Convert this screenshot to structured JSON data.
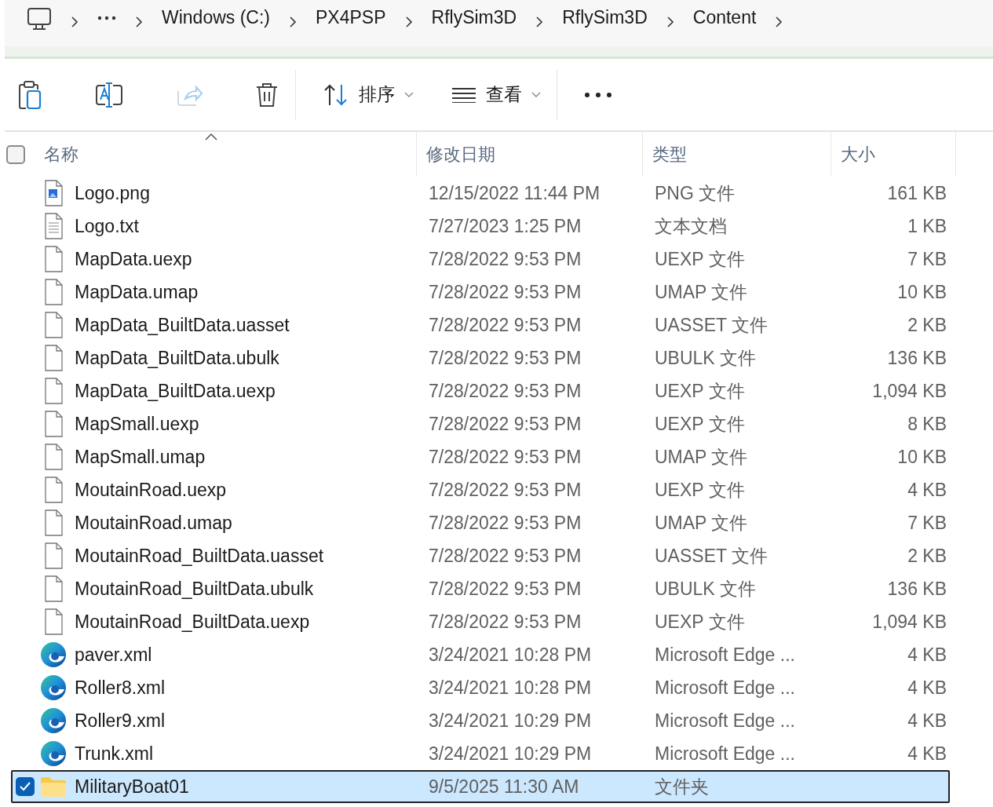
{
  "breadcrumb": [
    {
      "kind": "computer"
    },
    {
      "kind": "overflow"
    },
    {
      "kind": "text",
      "label": "Windows (C:)"
    },
    {
      "kind": "text",
      "label": "PX4PSP"
    },
    {
      "kind": "text",
      "label": "RflySim3D"
    },
    {
      "kind": "text",
      "label": "RflySim3D"
    },
    {
      "kind": "text",
      "label": "Content"
    }
  ],
  "toolbar": [
    {
      "kind": "paste",
      "disabled": false
    },
    {
      "kind": "rename",
      "disabled": false
    },
    {
      "kind": "share",
      "disabled": true
    },
    {
      "kind": "delete",
      "disabled": false
    },
    {
      "kind": "divider"
    },
    {
      "kind": "sort",
      "label": "排序",
      "disabled": false
    },
    {
      "kind": "view",
      "label": "查看",
      "disabled": false
    },
    {
      "kind": "divider"
    },
    {
      "kind": "more",
      "disabled": false
    }
  ],
  "header": {
    "checked": false,
    "columns": [
      "名称",
      "修改日期",
      "类型",
      "大小"
    ]
  },
  "rows": [
    {
      "name": "Logo.png",
      "date": "12/15/2022 11:44 PM",
      "type": "PNG 文件",
      "size": "161 KB",
      "kind": "image",
      "selected": false
    },
    {
      "name": "Logo.txt",
      "date": "7/27/2023 1:25 PM",
      "type": "文本文档",
      "size": "1 KB",
      "kind": "text",
      "selected": false
    },
    {
      "name": "MapData.uexp",
      "date": "7/28/2022 9:53 PM",
      "type": "UEXP 文件",
      "size": "7 KB",
      "kind": "file",
      "selected": false
    },
    {
      "name": "MapData.umap",
      "date": "7/28/2022 9:53 PM",
      "type": "UMAP 文件",
      "size": "10 KB",
      "kind": "file",
      "selected": false
    },
    {
      "name": "MapData_BuiltData.uasset",
      "date": "7/28/2022 9:53 PM",
      "type": "UASSET 文件",
      "size": "2 KB",
      "kind": "file",
      "selected": false
    },
    {
      "name": "MapData_BuiltData.ubulk",
      "date": "7/28/2022 9:53 PM",
      "type": "UBULK 文件",
      "size": "136 KB",
      "kind": "file",
      "selected": false
    },
    {
      "name": "MapData_BuiltData.uexp",
      "date": "7/28/2022 9:53 PM",
      "type": "UEXP 文件",
      "size": "1,094 KB",
      "kind": "file",
      "selected": false
    },
    {
      "name": "MapSmall.uexp",
      "date": "7/28/2022 9:53 PM",
      "type": "UEXP 文件",
      "size": "8 KB",
      "kind": "file",
      "selected": false
    },
    {
      "name": "MapSmall.umap",
      "date": "7/28/2022 9:53 PM",
      "type": "UMAP 文件",
      "size": "10 KB",
      "kind": "file",
      "selected": false
    },
    {
      "name": "MoutainRoad.uexp",
      "date": "7/28/2022 9:53 PM",
      "type": "UEXP 文件",
      "size": "4 KB",
      "kind": "file",
      "selected": false
    },
    {
      "name": "MoutainRoad.umap",
      "date": "7/28/2022 9:53 PM",
      "type": "UMAP 文件",
      "size": "7 KB",
      "kind": "file",
      "selected": false
    },
    {
      "name": "MoutainRoad_BuiltData.uasset",
      "date": "7/28/2022 9:53 PM",
      "type": "UASSET 文件",
      "size": "2 KB",
      "kind": "file",
      "selected": false
    },
    {
      "name": "MoutainRoad_BuiltData.ubulk",
      "date": "7/28/2022 9:53 PM",
      "type": "UBULK 文件",
      "size": "136 KB",
      "kind": "file",
      "selected": false
    },
    {
      "name": "MoutainRoad_BuiltData.uexp",
      "date": "7/28/2022 9:53 PM",
      "type": "UEXP 文件",
      "size": "1,094 KB",
      "kind": "file",
      "selected": false
    },
    {
      "name": "paver.xml",
      "date": "3/24/2021 10:28 PM",
      "type": "Microsoft Edge ...",
      "size": "4 KB",
      "kind": "edge",
      "selected": false
    },
    {
      "name": "Roller8.xml",
      "date": "3/24/2021 10:28 PM",
      "type": "Microsoft Edge ...",
      "size": "4 KB",
      "kind": "edge",
      "selected": false
    },
    {
      "name": "Roller9.xml",
      "date": "3/24/2021 10:29 PM",
      "type": "Microsoft Edge ...",
      "size": "4 KB",
      "kind": "edge",
      "selected": false
    },
    {
      "name": "Trunk.xml",
      "date": "3/24/2021 10:29 PM",
      "type": "Microsoft Edge ...",
      "size": "4 KB",
      "kind": "edge",
      "selected": false
    },
    {
      "name": "MilitaryBoat01",
      "date": "9/5/2025 11:30 AM",
      "type": "文件夹",
      "size": "",
      "kind": "folder",
      "selected": true
    }
  ]
}
